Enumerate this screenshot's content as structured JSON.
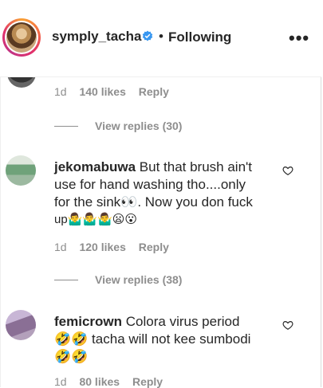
{
  "header": {
    "username": "symply_tacha",
    "separator": "•",
    "following_label": "Following",
    "more_label": "•••"
  },
  "top_comment": {
    "time": "1d",
    "likes": "140 likes",
    "reply_label": "Reply",
    "view_replies": "View replies (30)"
  },
  "comments": [
    {
      "username": "jekomabuwa",
      "lines": [
        "But that brush ain't",
        "use for hand washing tho....only",
        "for the sink👀. Now you don fuck",
        "up🤷‍♂️🤷‍♂️🤷‍♂️😦😮"
      ],
      "time": "1d",
      "likes": "120 likes",
      "reply_label": "Reply",
      "view_replies": "View replies (38)"
    },
    {
      "username": "femicrown",
      "lines": [
        "Colora virus period",
        "🤣🤣 tacha will not kee sumbodi",
        "🤣🤣"
      ],
      "time": "1d",
      "likes": "80 likes",
      "reply_label": "Reply"
    }
  ],
  "colors": {
    "text": "#262626",
    "muted": "#8e8e8e",
    "verified": "#3897f0"
  }
}
